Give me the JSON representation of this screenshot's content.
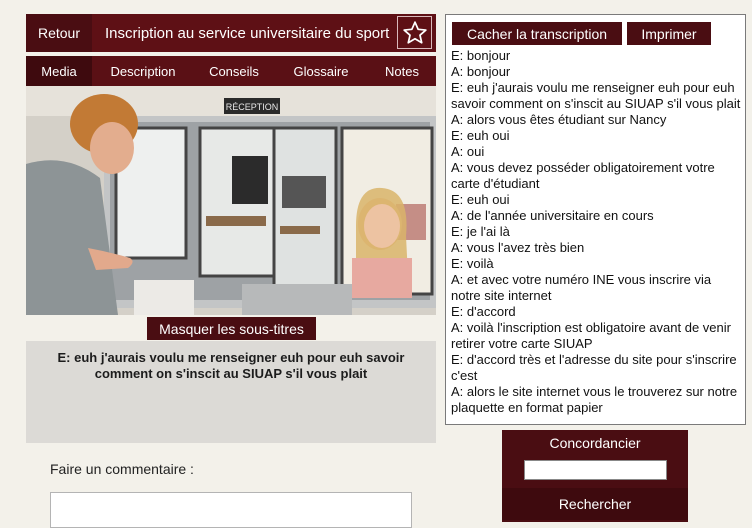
{
  "header": {
    "back_label": "Retour",
    "title": "Inscription au service universitaire du sport",
    "favorite_icon": "star-icon"
  },
  "nav": {
    "items": [
      {
        "label": "Media",
        "active": true
      },
      {
        "label": "Description",
        "active": false
      },
      {
        "label": "Conseils",
        "active": false
      },
      {
        "label": "Glossaire",
        "active": false
      },
      {
        "label": "Notes",
        "active": false
      }
    ]
  },
  "video": {
    "sign_text": "RÉCEPTION"
  },
  "subtitles": {
    "toggle_label": "Masquer les sous-titres",
    "current": "E: euh j'aurais voulu me renseigner euh pour euh savoir comment on s'inscit au SIUAP s'il vous plait"
  },
  "comment": {
    "label": "Faire un commentaire :",
    "value": ""
  },
  "transcript": {
    "hide_label": "Cacher la transcription",
    "print_label": "Imprimer",
    "lines": [
      "E: bonjour",
      "A: bonjour",
      "E: euh j'aurais voulu me renseigner euh pour euh savoir comment on s'inscit au SIUAP s'il vous plait",
      "A: alors vous êtes étudiant sur Nancy",
      "E: euh oui",
      "A: oui",
      "A: vous devez posséder obligatoirement votre carte d'étudiant",
      "E: euh oui",
      "A: de l'année universitaire en cours",
      "E: je l'ai là",
      "A: vous l'avez très bien",
      "E: voilà",
      "A: et avec votre numéro INE vous inscrire via notre site internet",
      "E: d'accord",
      "A: voilà l'inscription est obligatoire avant de venir retirer votre carte SIUAP",
      "E: d'accord très et l'adresse du site pour s'inscrire c'est",
      "A: alors le site internet vous le trouverez sur notre plaquette en format papier"
    ]
  },
  "concordancier": {
    "title": "Concordancier",
    "search_value": "",
    "search_button": "Rechercher"
  },
  "colors": {
    "accent_dark": "#4a0d12",
    "accent": "#5e1015",
    "background": "#f3f1ea"
  }
}
